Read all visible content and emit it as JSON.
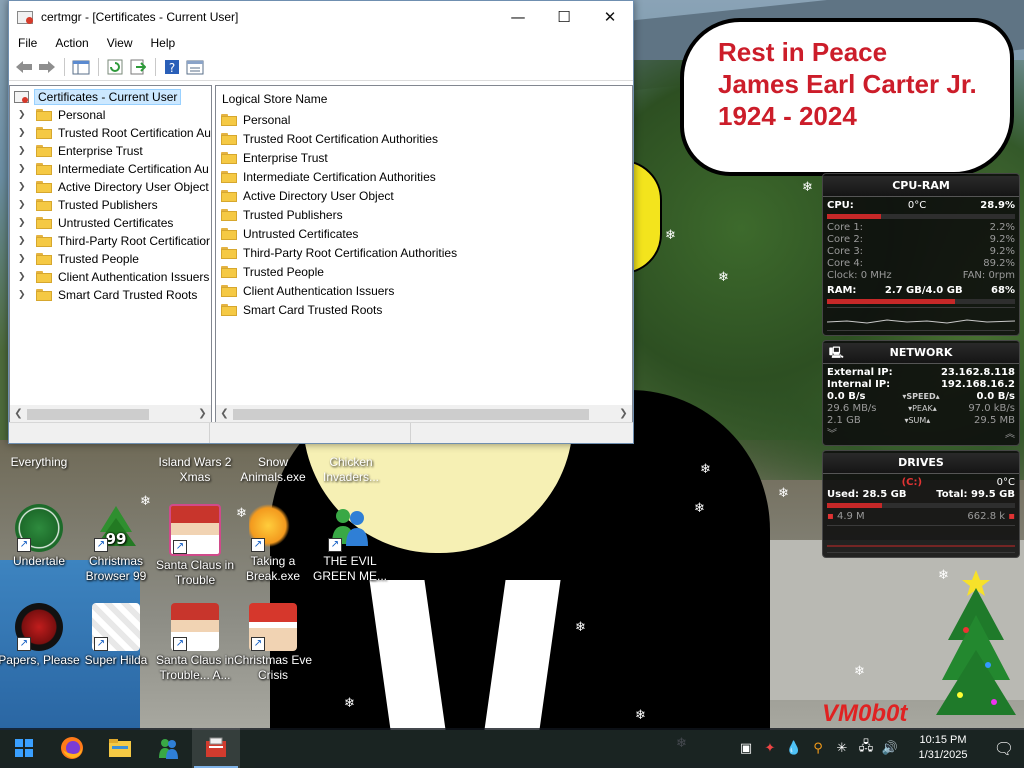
{
  "window": {
    "title": "certmgr - [Certificates - Current User]",
    "caption_buttons": {
      "minimize": "—",
      "maximize": "☐",
      "close": "✕"
    }
  },
  "menubar": {
    "items": [
      "File",
      "Action",
      "View",
      "Help"
    ]
  },
  "tree": {
    "root_label": "Certificates - Current User",
    "items": [
      "Personal",
      "Trusted Root Certification Au",
      "Enterprise Trust",
      "Intermediate Certification Au",
      "Active Directory User Object",
      "Trusted Publishers",
      "Untrusted Certificates",
      "Third-Party Root Certificatior",
      "Trusted People",
      "Client Authentication Issuers",
      "Smart Card Trusted Roots"
    ]
  },
  "list": {
    "column_header": "Logical Store Name",
    "items": [
      "Personal",
      "Trusted Root Certification Authorities",
      "Enterprise Trust",
      "Intermediate Certification Authorities",
      "Active Directory User Object",
      "Trusted Publishers",
      "Untrusted Certificates",
      "Third-Party Root Certification Authorities",
      "Trusted People",
      "Client Authentication Issuers",
      "Smart Card Trusted Roots"
    ]
  },
  "wallpaper": {
    "bubble_lines": [
      "Rest in Peace",
      "James Earl Carter Jr.",
      "1924 - 2024"
    ],
    "watermark": "VM0b0t"
  },
  "desktop_icons": [
    {
      "label": "Everything",
      "icon": "everything-icon"
    },
    {
      "label": "Island Wars 2 Xmas",
      "icon": "island-wars-icon"
    },
    {
      "label": "Snow Animals.exe",
      "icon": "snow-animals-icon"
    },
    {
      "label": "Chicken Invaders...",
      "icon": "chicken-invaders-icon"
    },
    {
      "label": "Undertale",
      "icon": "undertale-icon"
    },
    {
      "label": "Christmas Browser 99",
      "icon": "christmas-tree-icon",
      "badge": "99"
    },
    {
      "label": "Santa Claus in Trouble",
      "icon": "santa-icon"
    },
    {
      "label": "Taking a Break.exe",
      "icon": "taking-break-icon"
    },
    {
      "label": "THE EVIL GREEN ME...",
      "icon": "messenger-icon"
    },
    {
      "label": "Papers, Please",
      "icon": "papers-please-icon"
    },
    {
      "label": "Super Hilda",
      "icon": "super-hilda-icon"
    },
    {
      "label": "Santa Claus in Trouble... A...",
      "icon": "santa-icon"
    },
    {
      "label": "Christmas Eve Crisis",
      "icon": "santa-hat-icon"
    }
  ],
  "gadget": {
    "cpu_ram": {
      "title": "CPU-RAM",
      "cpu_label": "CPU:",
      "cpu_temp": "0°C",
      "cpu_value": "28.9%",
      "cores": [
        {
          "label": "Core 1:",
          "value": "2.2%"
        },
        {
          "label": "Core 2:",
          "value": "9.2%"
        },
        {
          "label": "Core 3:",
          "value": "9.2%"
        },
        {
          "label": "Core 4:",
          "value": "89.2%"
        }
      ],
      "clock": "Clock: 0 MHz",
      "fan": "FAN: 0rpm",
      "ram_label": "RAM:",
      "ram_value": "2.7 GB/4.0 GB",
      "ram_percent": "68%",
      "ram_fraction": 0.68
    },
    "network": {
      "title": "NETWORK",
      "external_label": "External IP:",
      "external_ip": "23.162.8.118",
      "internal_label": "Internal IP:",
      "internal_ip": "192.168.16.2",
      "speed_down": "0.0 B/s",
      "speed_label": "SPEED",
      "speed_up": "0.0 B/s",
      "peak_down": "29.6 MB/s",
      "peak_label": "PEAK",
      "peak_up": "97.0 kB/s",
      "sum_down": "2.1 GB",
      "sum_label": "SUM",
      "sum_up": "29.5 MB"
    },
    "drives": {
      "title": "DRIVES",
      "drive": "(C:)",
      "temp": "0°C",
      "used": "Used: 28.5 GB",
      "total": "Total: 99.5 GB",
      "read": "4.9 M",
      "write": "662.8 k",
      "used_fraction": 0.29
    }
  },
  "taskbar": {
    "apps": [
      "start-icon",
      "firefox-icon",
      "file-explorer-icon",
      "messenger-icon",
      "certmgr-icon"
    ],
    "clock_time": "10:15 PM",
    "clock_date": "1/31/2025"
  },
  "colors": {
    "bubble_text": "#cc1d2a",
    "selection": "#cce8ff",
    "folder": "#f5c944",
    "gadget_red": "#e03333"
  }
}
